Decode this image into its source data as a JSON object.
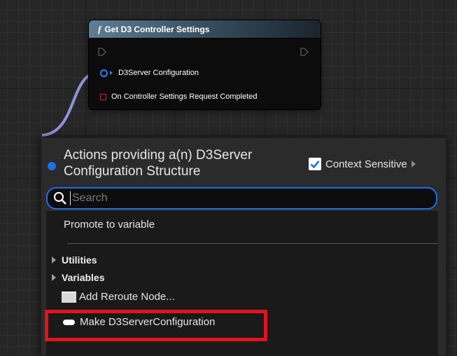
{
  "node": {
    "func_icon": "f",
    "title": "Get D3 Controller Settings",
    "output_pins": [
      {
        "label": "D3Server Configuration",
        "color": "#3c7cf0"
      },
      {
        "label": "On Controller Settings Request Completed",
        "color": "#d0252a"
      }
    ]
  },
  "menu": {
    "header_title": "Actions providing a(n) D3Server Configuration Structure",
    "context_sensitive_label": "Context Sensitive",
    "context_sensitive_checked": true,
    "search_placeholder": "Search",
    "search_value": "",
    "promote_label": "Promote to variable",
    "categories": [
      {
        "label": "Utilities"
      },
      {
        "label": "Variables"
      }
    ],
    "items": [
      {
        "label": "Add Reroute Node...",
        "icon": "reroute-node-icon"
      },
      {
        "label": "Make D3ServerConfiguration",
        "icon": "struct-make-icon"
      }
    ]
  },
  "colors": {
    "accent": "#1f6fe8",
    "struct_pin": "#3c7cf0",
    "delegate_pin": "#d0252a",
    "highlight": "#e0141e"
  }
}
